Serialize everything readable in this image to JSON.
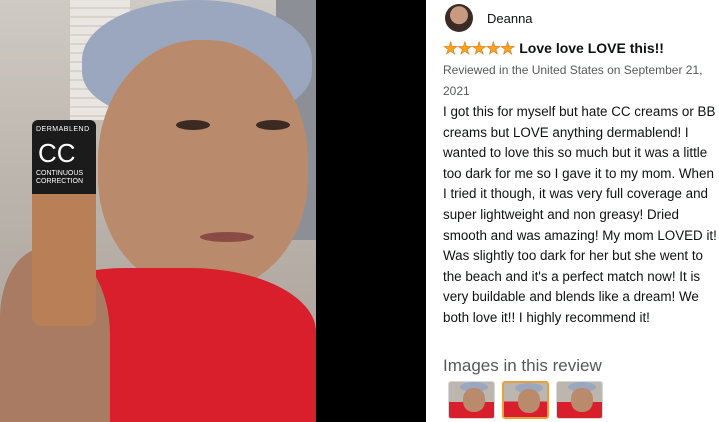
{
  "review_photo": {
    "product_brand": "DERMABLEND",
    "product_name": "CC",
    "product_subtitle": "CONTINUOUS CORRECTION"
  },
  "review": {
    "profile_name": "Deanna",
    "rating": 5,
    "rating_max": 5,
    "title": "Love love LOVE this!!",
    "date": "Reviewed in the United States on September 21, 2021",
    "body": "I got this for myself but hate CC creams or BB creams but LOVE anything dermablend! I wanted to love this so much but it was a little too dark for me so I gave it to my mom. When I tried it though, it was very full coverage and super lightweight and non greasy! Dried smooth and was amazing! My mom LOVED it! Was slightly too dark for her but she went to the beach and it's a perfect match now! It is very buildable and blends like a dream! We both love it!! I highly recommend it!",
    "images_heading": "Images in this review",
    "thumbnails": [
      {
        "selected": false
      },
      {
        "selected": true
      },
      {
        "selected": false
      }
    ]
  },
  "colors": {
    "star": "#f7a51c",
    "selected_border": "#e7a03c",
    "secondary_text": "#565959"
  }
}
